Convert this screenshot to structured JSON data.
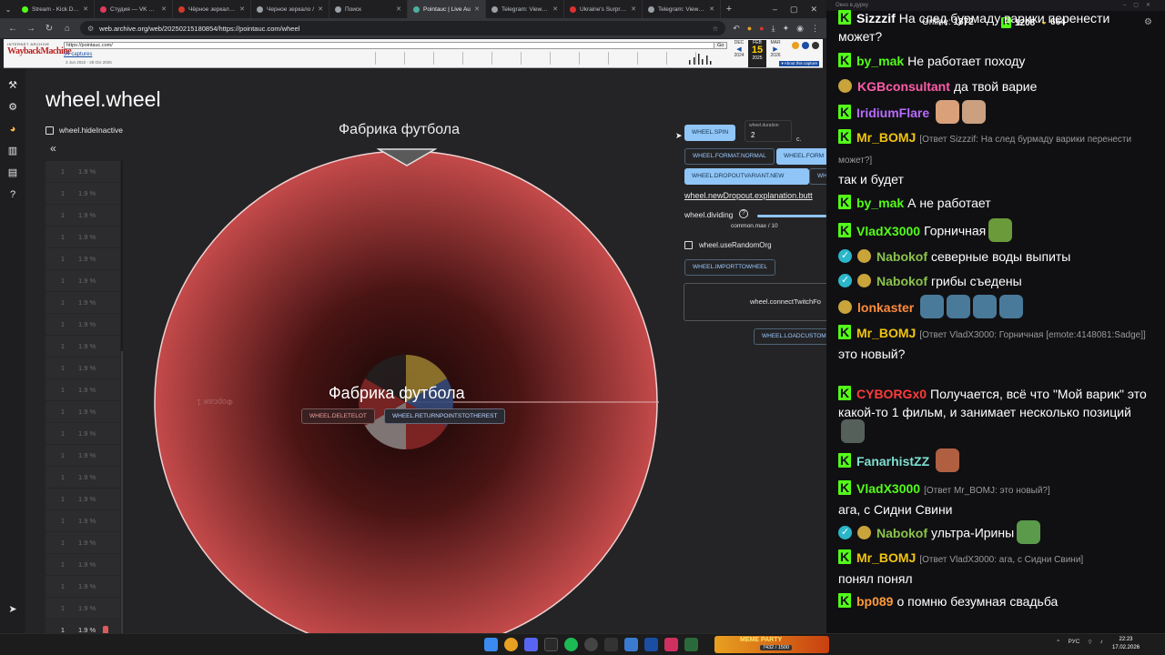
{
  "browser": {
    "tabs": [
      {
        "title": "Stream - Kick Dash",
        "color": "#53fc18",
        "active": false
      },
      {
        "title": "Студия — VK Видео",
        "color": "#e03a5c",
        "active": false
      },
      {
        "title": "Чёрное зеркало (с",
        "color": "#d43a2a",
        "active": false
      },
      {
        "title": "Черное зеркало / ",
        "color": "#9aa0a6",
        "active": false
      },
      {
        "title": "Поиск",
        "color": "#9aa0a6",
        "active": false
      },
      {
        "title": "Pointauc | Live Au",
        "color": "#4cafa0",
        "active": true
      },
      {
        "title": "Telegram: View @",
        "color": "#9aa0a6",
        "active": false
      },
      {
        "title": "Ukraine's Surprise",
        "color": "#e03030",
        "active": false
      },
      {
        "title": "Telegram: View @",
        "color": "#9aa0a6",
        "active": false
      }
    ],
    "new_tab": "+",
    "window_controls": [
      "–",
      "▢",
      "✕"
    ],
    "url": "web.archive.org/web/20250215180854/https://pointauc.com/wheel"
  },
  "wayback": {
    "ia_label": "INTERNET ARCHIVE",
    "logo": "WaybackMachine",
    "url_field": "https://pointauc.com/",
    "go": "Go",
    "captures": "54 captures",
    "range": "3 Jun 2022 - 28 Oct 2025",
    "months": [
      "DEC",
      "FEB",
      "MAR"
    ],
    "day": "15",
    "years": [
      "2024",
      "2025",
      "2026"
    ],
    "about": "▾ About this capture"
  },
  "app": {
    "title": "wheel.wheel",
    "hide_inactive": "wheel.hideInactive",
    "collapse": "«",
    "lots": [
      {
        "num": "1",
        "pct": "1.9 %"
      },
      {
        "num": "1",
        "pct": "1.9 %"
      },
      {
        "num": "1",
        "pct": "1.9 %"
      },
      {
        "num": "1",
        "pct": "1.9 %"
      },
      {
        "num": "1",
        "pct": "1.9 %"
      },
      {
        "num": "1",
        "pct": "1.9 %"
      },
      {
        "num": "1",
        "pct": "1.9 %"
      },
      {
        "num": "1",
        "pct": "1.9 %"
      },
      {
        "num": "1",
        "pct": "1.9 %"
      },
      {
        "num": "1",
        "pct": "1.9 %"
      },
      {
        "num": "1",
        "pct": "1.9 %"
      },
      {
        "num": "1",
        "pct": "1.9 %"
      },
      {
        "num": "1",
        "pct": "1.9 %"
      },
      {
        "num": "1",
        "pct": "1.9 %"
      },
      {
        "num": "1",
        "pct": "1.9 %"
      },
      {
        "num": "1",
        "pct": "1.9 %"
      },
      {
        "num": "1",
        "pct": "1.9 %"
      },
      {
        "num": "1",
        "pct": "1.9 %"
      },
      {
        "num": "1",
        "pct": "1.9 %"
      },
      {
        "num": "1",
        "pct": "1.9 %"
      },
      {
        "num": "1",
        "pct": "1.9 %"
      },
      {
        "num": "1",
        "pct": "1.9 %"
      }
    ],
    "wheel_title": "Фабрика футбола",
    "slice_label": "Форсаж 1",
    "winner": "Фабрика футбола",
    "delete_lot": "WHEEL.DELETELOT",
    "return_points": "WHEEL.RETURNPOINTSTOTHEREST",
    "spin": "WHEEL.SPIN",
    "duration_label": "wheel.duration",
    "duration_value": "2",
    "duration_unit": "с.",
    "format_normal": "WHEEL.FORMAT.NORMAL",
    "format_other": "WHEEL.FORM",
    "dropout_new": "WHEEL.DROPOUTVARIANT.NEW",
    "dropout_other": "WH",
    "dropout_expl": "wheel.newDropout.explanation.butt",
    "dividing": "wheel.dividing",
    "dividing_help": "?",
    "dividing_sub": "common.max / 10",
    "use_random_org": "wheel.useRandomOrg",
    "import": "WHEEL.IMPORTTOWHEEL",
    "connect_twitch": "wheel.connectTwitchFo",
    "load_custom": "WHEEL.LOADCUSTOM"
  },
  "chat": {
    "top_text": "Окно в.дурку",
    "online_label": "Online:",
    "online_count": "1872",
    "k_count": "1208",
    "coins": "664",
    "messages": [
      {
        "user": "Sizzzif",
        "color": "#ffffff",
        "badges": [
          "kb"
        ],
        "text": "На след бурмаду варики перенести может?",
        "emotes": []
      },
      {
        "user": "by_mak",
        "color": "#53fc18",
        "badges": [
          "kb"
        ],
        "text": "Не работает походу",
        "emotes": []
      },
      {
        "user": "KGBconsultant",
        "color": "#ff5ca8",
        "badges": [
          "pepe"
        ],
        "text": "да твой варие",
        "emotes": []
      },
      {
        "user": "IridiumFlare",
        "color": "#b86bff",
        "badges": [
          "kb"
        ],
        "text": "",
        "emotes": [
          "#d9a07a",
          "#caa080"
        ]
      },
      {
        "user": "Mr_BOMJ",
        "color": "#f1c40f",
        "badges": [
          "kb"
        ],
        "reply": "[Ответ Sizzzif: На след бурмаду варики перенести может?]",
        "text": "так и будет",
        "emotes": []
      },
      {
        "user": "by_mak",
        "color": "#53fc18",
        "badges": [
          "kb"
        ],
        "text": "А не работает",
        "emotes": []
      },
      {
        "user": "VladX3000",
        "color": "#53fc18",
        "badges": [
          "kb"
        ],
        "text": "Горничная",
        "emotes": [
          "#6a9a3a"
        ]
      },
      {
        "user": "Nabokof",
        "color": "#8bc34a",
        "badges": [
          "ver",
          "pepe"
        ],
        "text": "северные воды выпиты",
        "emotes": []
      },
      {
        "user": "Nabokof",
        "color": "#8bc34a",
        "badges": [
          "ver",
          "pepe"
        ],
        "text": "грибы съедены",
        "emotes": []
      },
      {
        "user": "lonkaster",
        "color": "#ff8c3a",
        "badges": [
          "pepe"
        ],
        "text": "",
        "emotes": [
          "#4a7a9a",
          "#4a7a9a",
          "#4a7a9a",
          "#4a7a9a"
        ]
      },
      {
        "user": "Mr_BOMJ",
        "color": "#f1c40f",
        "badges": [
          "kb"
        ],
        "reply": "[Ответ VladX3000: Горничная [emote:4148081:Sadge]]",
        "text": "это новый?",
        "emotes": []
      },
      {
        "user": "CYBORGx0",
        "color": "#ff3b3b",
        "badges": [
          "kb"
        ],
        "text": "Получается, всё что \"Мой варик\" это какой-то 1 фильм, и занимает несколько позиций",
        "emotes": [
          "#55605a"
        ]
      },
      {
        "user": "FanarhistZZ",
        "color": "#7ee0d0",
        "badges": [
          "kb"
        ],
        "text": "",
        "emotes": [
          "#b06040"
        ]
      },
      {
        "user": "VladX3000",
        "color": "#53fc18",
        "badges": [
          "kb"
        ],
        "reply": "[Ответ Mr_BOMJ: это новый?]",
        "text": "ага, с Сидни Свини",
        "emotes": []
      },
      {
        "user": "Nabokof",
        "color": "#8bc34a",
        "badges": [
          "ver",
          "pepe"
        ],
        "text": "ультра-Ирины",
        "emotes": [
          "#5a9a4a"
        ]
      },
      {
        "user": "Mr_BOMJ",
        "color": "#f1c40f",
        "badges": [
          "kb"
        ],
        "reply": "[Ответ VladX3000: ага, с Сидни Свини]",
        "text": "понял понял",
        "emotes": []
      },
      {
        "user": "bp089",
        "color": "#ff9a3a",
        "badges": [
          "kb"
        ],
        "text": "о помню безумная свадьба",
        "emotes": []
      }
    ]
  },
  "taskbar": {
    "game_name": "MEME PARTY",
    "game_sub": "7432 / 1500",
    "lang": "РУС",
    "time": "22:23",
    "date": "17.02.2026"
  }
}
